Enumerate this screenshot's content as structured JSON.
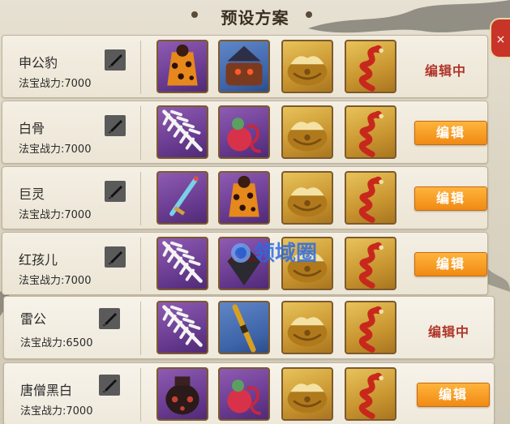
{
  "panel": {
    "title": "预设方案",
    "close_icon": "×"
  },
  "colors": {
    "edit_button": "#f08a14",
    "editing_text": "#b0352a",
    "watermark": "#2a6be8"
  },
  "presets": [
    {
      "name": "申公豹",
      "power": "法宝战力:7000",
      "action": "编辑中",
      "active": true,
      "slots": [
        "purple-robe-item-icon",
        "blue-cauldron-monster-icon",
        "gold-lotus-base-icon",
        "gold-fire-dragon-icon"
      ]
    },
    {
      "name": "白骨",
      "power": "法宝战力:7000",
      "action": "编辑",
      "active": false,
      "slots": [
        "purple-white-feather-blade-icon",
        "purple-red-gourd-icon",
        "gold-lotus-base-icon",
        "gold-fire-dragon-icon"
      ]
    },
    {
      "name": "巨灵",
      "power": "法宝战力:7000",
      "action": "编辑",
      "active": false,
      "slots": [
        "purple-jade-sword-icon",
        "purple-robe-item-icon",
        "gold-lotus-base-icon",
        "gold-fire-dragon-icon"
      ]
    },
    {
      "name": "红孩儿",
      "power": "法宝战力:7000",
      "action": "编辑",
      "active": false,
      "slots": [
        "purple-white-feather-blade-icon",
        "purple-dark-gem-icon",
        "gold-lotus-base-icon",
        "gold-fire-dragon-icon"
      ]
    },
    {
      "name": "雷公",
      "power": "法宝战力:6500",
      "action": "编辑中",
      "active": true,
      "slots": [
        "purple-white-feather-blade-icon",
        "blue-golden-staff-icon",
        "gold-lotus-base-icon",
        "gold-fire-dragon-icon"
      ]
    },
    {
      "name": "唐僧黑白",
      "power": "法宝战力:7000",
      "action": "编辑",
      "active": false,
      "slots": [
        "purple-black-urn-icon",
        "purple-red-gourd-icon",
        "gold-lotus-base-icon",
        "gold-fire-dragon-icon"
      ]
    }
  ],
  "watermark": {
    "text": "领域圈",
    "icon": "circle-logo-icon"
  }
}
